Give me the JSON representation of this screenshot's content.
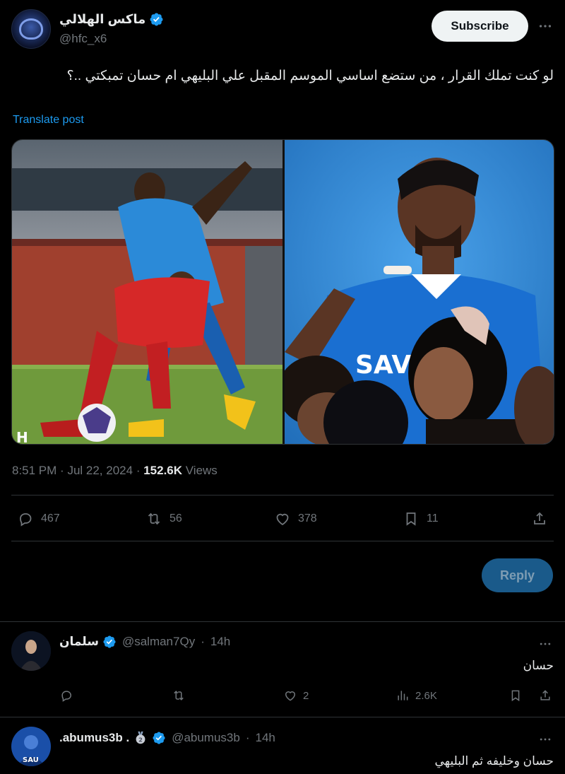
{
  "post": {
    "author_name": "ماكس الهلالي",
    "handle": "@hfc_x6",
    "subscribe_label": "Subscribe",
    "text": "لو كنت تملك القرار ، من ستضع اساسي الموسم المقبل علي البليهي ام حسان تمبكتي ..؟",
    "translate_label": "Translate post",
    "time": "8:51 PM",
    "date": "Jul 22, 2024",
    "views_count": "152.6K",
    "views_label": "Views",
    "stats": {
      "replies": "467",
      "reposts": "56",
      "likes": "378",
      "bookmarks": "11"
    },
    "reply_button": "Reply"
  },
  "replies": [
    {
      "name": "سلمان",
      "handle": "@salman7Qy",
      "time": "14h",
      "text": "حسان",
      "stats": {
        "replies": "",
        "reposts": "",
        "likes": "2",
        "views": "2.6K"
      }
    },
    {
      "name": ".abumus3b .",
      "handle": "@abumus3b",
      "time": "14h",
      "text": "حسان وخليفه ثم البليهي",
      "badge": "2"
    }
  ],
  "colors": {
    "accent": "#1d9bf0",
    "background": "#000000",
    "muted": "#71767b",
    "text": "#e7e9ea",
    "hilal_blue": "#1a6fd1",
    "opponent_red": "#d62828"
  }
}
